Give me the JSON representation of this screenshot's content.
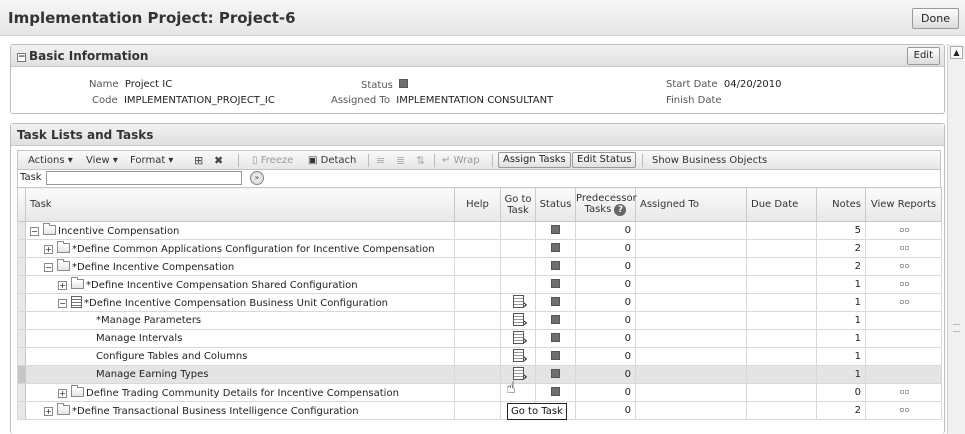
{
  "header": {
    "title": "Implementation Project: Project-6",
    "done_label": "Done"
  },
  "basic_info": {
    "title": "Basic Information",
    "edit_label": "Edit",
    "name_label": "Name",
    "name_value": "Project IC",
    "code_label": "Code",
    "code_value": "IMPLEMENTATION_PROJECT_IC",
    "status_label": "Status",
    "assigned_label": "Assigned To",
    "assigned_value": "IMPLEMENTATION CONSULTANT",
    "start_label": "Start Date",
    "start_value": "04/20/2010",
    "finish_label": "Finish Date",
    "finish_value": ""
  },
  "tasks_panel": {
    "title": "Task Lists and Tasks",
    "toolbar": {
      "actions": "Actions ▾",
      "view": "View ▾",
      "format": "Format ▾",
      "freeze": "Freeze",
      "detach": "Detach",
      "wrap": "Wrap",
      "assign_tasks": "Assign Tasks",
      "edit_status": "Edit Status",
      "show_business_objects": "Show Business Objects"
    },
    "filter": {
      "label": "Task",
      "value": ""
    },
    "columns": {
      "task": "Task",
      "help": "Help",
      "goto_l1": "Go to",
      "goto_l2": "Task",
      "status": "Status",
      "pred_l1": "Predecessor",
      "pred_l2": "Tasks",
      "assigned": "Assigned To",
      "due": "Due Date",
      "notes": "Notes",
      "reports": "View Reports"
    },
    "rows": [
      {
        "task": "Incentive Compensation",
        "tree": "minus",
        "icon": "folder",
        "star": false,
        "goto": false,
        "pred": "0",
        "notes": "5",
        "reports": true,
        "indent": 0
      },
      {
        "task": "*Define Common Applications Configuration for Incentive Compensation",
        "tree": "plus",
        "icon": "folder",
        "goto": false,
        "pred": "0",
        "notes": "2",
        "reports": true,
        "indent": 1
      },
      {
        "task": "*Define Incentive Compensation",
        "tree": "minus",
        "icon": "folder",
        "goto": false,
        "pred": "0",
        "notes": "2",
        "reports": true,
        "indent": 1
      },
      {
        "task": "*Define Incentive Compensation Shared Configuration",
        "tree": "plus",
        "icon": "folder",
        "goto": false,
        "pred": "0",
        "notes": "1",
        "reports": true,
        "indent": 2
      },
      {
        "task": "*Define Incentive Compensation Business Unit Configuration",
        "tree": "minus",
        "icon": "list",
        "goto": true,
        "pred": "0",
        "notes": "1",
        "reports": true,
        "indent": 2
      },
      {
        "task": "*Manage Parameters",
        "tree": "none",
        "icon": "none",
        "goto": true,
        "pred": "0",
        "notes": "1",
        "reports": false,
        "indent": 4
      },
      {
        "task": "Manage Intervals",
        "tree": "none",
        "icon": "none",
        "goto": true,
        "pred": "0",
        "notes": "1",
        "reports": false,
        "indent": 4
      },
      {
        "task": "Configure Tables and Columns",
        "tree": "none",
        "icon": "none",
        "goto": true,
        "pred": "0",
        "notes": "1",
        "reports": false,
        "indent": 4
      },
      {
        "task": "Manage Earning Types",
        "tree": "none",
        "icon": "none",
        "goto": true,
        "pred": "0",
        "notes": "1",
        "reports": false,
        "indent": 4,
        "selected": true
      },
      {
        "task": "Define Trading Community Details for Incentive Compensation",
        "tree": "plus",
        "icon": "folder",
        "goto": false,
        "pred": "0",
        "notes": "0",
        "reports": true,
        "indent": 2
      },
      {
        "task": "*Define Transactional Business Intelligence Configuration",
        "tree": "plus",
        "icon": "folder",
        "goto": false,
        "pred": "0",
        "notes": "2",
        "reports": true,
        "indent": 1
      }
    ]
  },
  "tooltip": "Go to Task",
  "icons": {
    "status": "status-square-icon",
    "goto": "go-to-task-icon",
    "reports": "glasses-icon",
    "help": "help-icon",
    "folder": "folder-icon",
    "list": "task-list-icon"
  }
}
